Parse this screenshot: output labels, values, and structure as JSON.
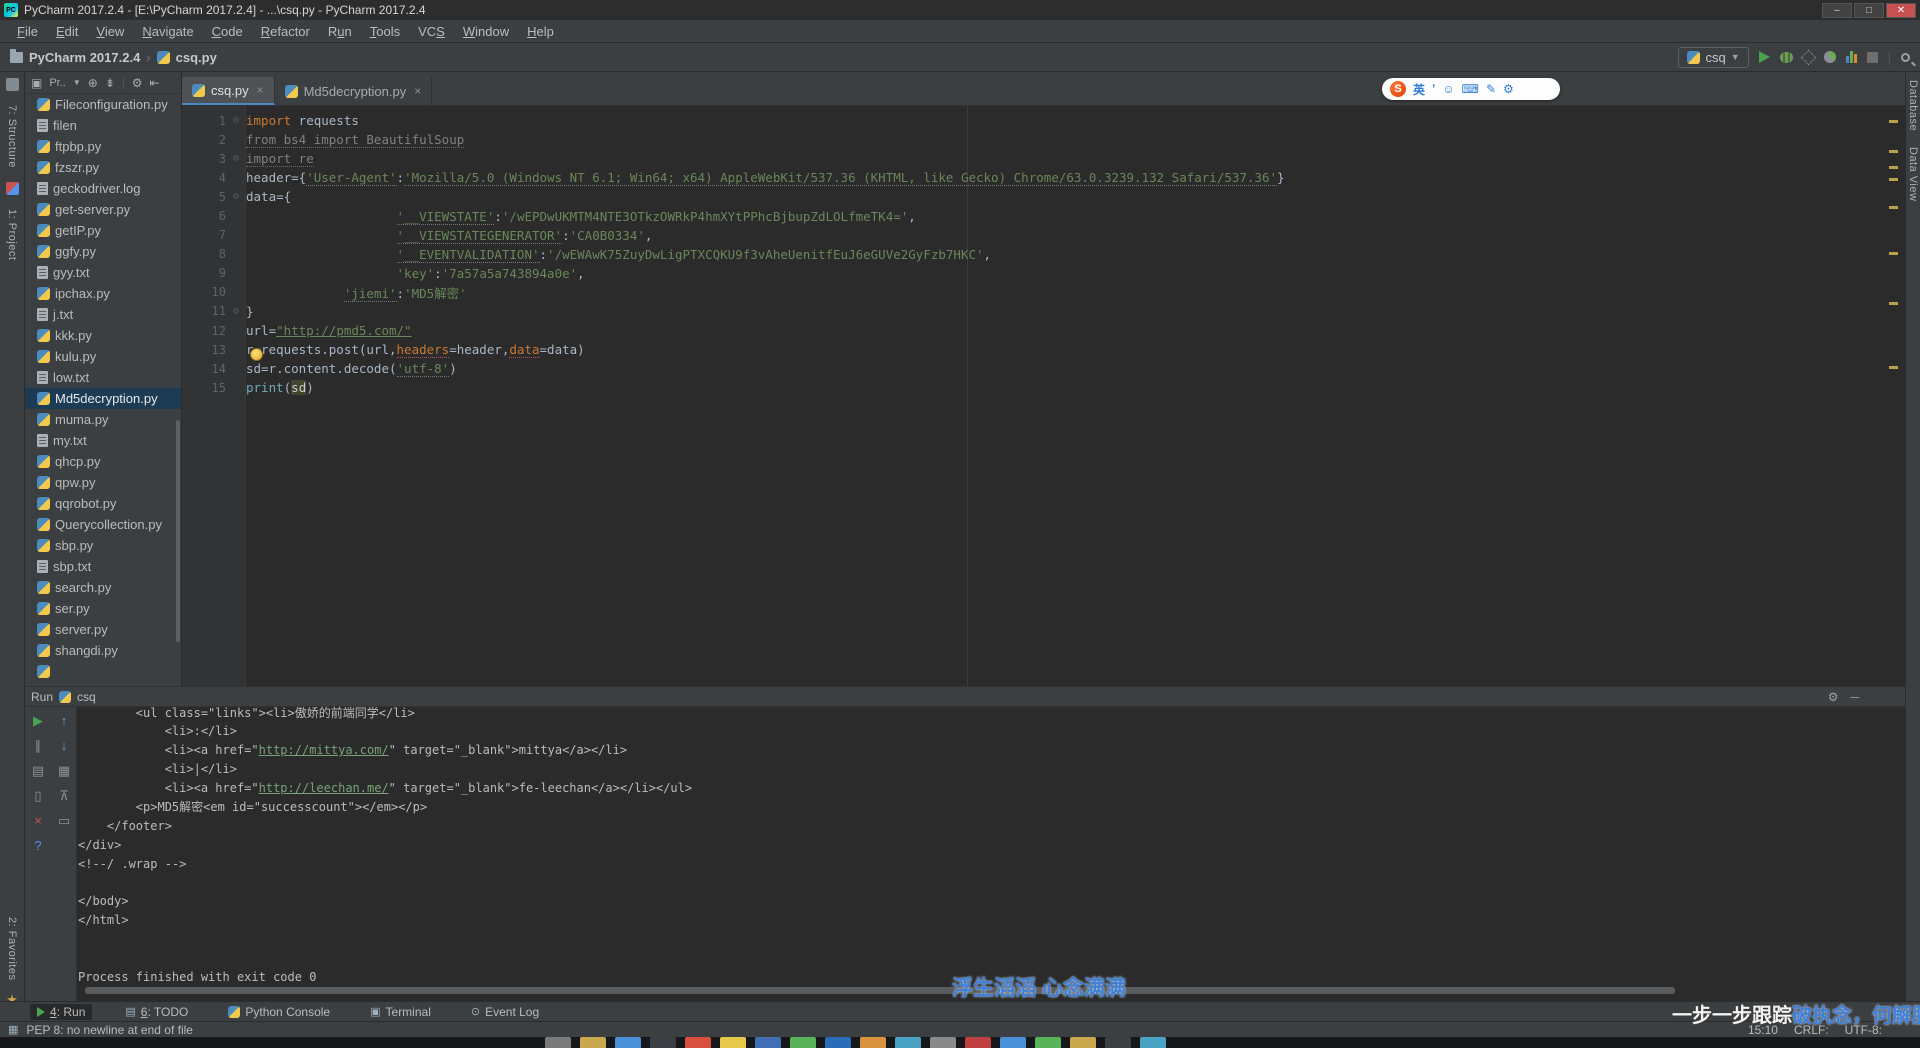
{
  "window": {
    "title": "PyCharm 2017.2.4 - [E:\\PyCharm 2017.2.4] - ...\\csq.py - PyCharm 2017.2.4",
    "controls": [
      "minimize",
      "maximize",
      "close"
    ]
  },
  "menu": {
    "items": [
      {
        "label": "File",
        "m": 0
      },
      {
        "label": "Edit",
        "m": 0
      },
      {
        "label": "View",
        "m": 0
      },
      {
        "label": "Navigate",
        "m": 0
      },
      {
        "label": "Code",
        "m": 0
      },
      {
        "label": "Refactor",
        "m": 0
      },
      {
        "label": "Run",
        "m": 1
      },
      {
        "label": "Tools",
        "m": 0
      },
      {
        "label": "VCS",
        "m": 2
      },
      {
        "label": "Window",
        "m": 0
      },
      {
        "label": "Help",
        "m": 0
      }
    ]
  },
  "toolbar": {
    "breadcrumb": [
      {
        "label": "PyCharm 2017.2.4",
        "icon": "folder-icon"
      },
      {
        "label": "csq.py",
        "icon": "python-icon"
      }
    ],
    "run_config": "csq"
  },
  "left_stripe": {
    "structure_label": "7: Structure",
    "project_label": "1: Project",
    "favorites_label": "2: Favorites"
  },
  "right_stripe": {
    "labels": [
      "Database",
      "Data View"
    ]
  },
  "project": {
    "view_label": "Pr..",
    "files": [
      {
        "name": "Fileconfiguration.py",
        "type": "py"
      },
      {
        "name": "filen",
        "type": "txt"
      },
      {
        "name": "ftpbp.py",
        "type": "py"
      },
      {
        "name": "fzszr.py",
        "type": "py"
      },
      {
        "name": "geckodriver.log",
        "type": "txt"
      },
      {
        "name": "get-server.py",
        "type": "py"
      },
      {
        "name": "getIP.py",
        "type": "py"
      },
      {
        "name": "ggfy.py",
        "type": "py"
      },
      {
        "name": "gyy.txt",
        "type": "txt"
      },
      {
        "name": "ipchax.py",
        "type": "py"
      },
      {
        "name": "j.txt",
        "type": "txt"
      },
      {
        "name": "kkk.py",
        "type": "py"
      },
      {
        "name": "kulu.py",
        "type": "py"
      },
      {
        "name": "low.txt",
        "type": "txt"
      },
      {
        "name": "Md5decryption.py",
        "type": "py",
        "selected": true
      },
      {
        "name": "muma.py",
        "type": "py"
      },
      {
        "name": "my.txt",
        "type": "txt"
      },
      {
        "name": "qhcp.py",
        "type": "py"
      },
      {
        "name": "qpw.py",
        "type": "py"
      },
      {
        "name": "qqrobot.py",
        "type": "py"
      },
      {
        "name": "Querycollection.py",
        "type": "py"
      },
      {
        "name": "sbp.py",
        "type": "py"
      },
      {
        "name": "sbp.txt",
        "type": "txt"
      },
      {
        "name": "search.py",
        "type": "py"
      },
      {
        "name": "ser.py",
        "type": "py"
      },
      {
        "name": "server.py",
        "type": "py"
      },
      {
        "name": "shangdi.py",
        "type": "py"
      },
      {
        "name": "",
        "type": "py",
        "partial": true
      }
    ]
  },
  "tabs": [
    {
      "label": "csq.py",
      "active": true
    },
    {
      "label": "Md5decryption.py",
      "active": false
    }
  ],
  "editor": {
    "lines": [
      {
        "n": 1,
        "fold": true,
        "segs": [
          {
            "t": "import",
            "c": "kw"
          },
          {
            "t": " requests"
          }
        ]
      },
      {
        "n": 2,
        "segs": [
          {
            "t": "from bs4 import BeautifulSoup",
            "c": "gray"
          }
        ]
      },
      {
        "n": 3,
        "fold": true,
        "segs": [
          {
            "t": "import re",
            "c": "gray"
          }
        ]
      },
      {
        "n": 4,
        "segs": [
          {
            "t": "header={"
          },
          {
            "t": "'User-Agent'",
            "c": "key"
          },
          {
            "t": ":"
          },
          {
            "t": "'Mozilla/5.0 (Windows NT 6.1; Win64; x64) AppleWebKit/537.36 (KHTML, like Gecko) Chrome/63.0.3239.132 Safari/537.36'",
            "c": "key"
          },
          {
            "t": "}"
          }
        ]
      },
      {
        "n": 5,
        "fold": true,
        "segs": [
          {
            "t": "data={"
          }
        ]
      },
      {
        "n": 6,
        "segs": [
          {
            "t": "                    "
          },
          {
            "t": "'__VIEWSTATE'",
            "c": "key"
          },
          {
            "t": ":"
          },
          {
            "t": "'/wEPDwUKMTM4NTE3OTkzOWRkP4hmXYtPPhcBjbupZdLOLfmeTK4='",
            "c": "str"
          },
          {
            "t": ","
          }
        ]
      },
      {
        "n": 7,
        "segs": [
          {
            "t": "                    "
          },
          {
            "t": "'__VIEWSTATEGENERATOR'",
            "c": "key"
          },
          {
            "t": ":"
          },
          {
            "t": "'CA0B0334'",
            "c": "str"
          },
          {
            "t": ","
          }
        ]
      },
      {
        "n": 8,
        "segs": [
          {
            "t": "                    "
          },
          {
            "t": "'__EVENTVALIDATION'",
            "c": "key"
          },
          {
            "t": ":"
          },
          {
            "t": "'/wEWAwK75ZuyDwLigPTXCQKU9f3vAheUenitfEuJ6eGUVe2GyFzb7HKC'",
            "c": "str"
          },
          {
            "t": ","
          }
        ]
      },
      {
        "n": 9,
        "segs": [
          {
            "t": "                    "
          },
          {
            "t": "'key'",
            "c": "str"
          },
          {
            "t": ":"
          },
          {
            "t": "'7a57a5a743894a0e'",
            "c": "str"
          },
          {
            "t": ","
          }
        ]
      },
      {
        "n": 10,
        "segs": [
          {
            "t": "             "
          },
          {
            "t": "'jiemi'",
            "c": "key"
          },
          {
            "t": ":"
          },
          {
            "t": "'MD5解密'",
            "c": "str"
          }
        ]
      },
      {
        "n": 11,
        "fold": true,
        "segs": [
          {
            "t": "}"
          }
        ]
      },
      {
        "n": 12,
        "segs": [
          {
            "t": "url="
          },
          {
            "t": "\"http://pmd5.com/\"",
            "c": "url"
          }
        ]
      },
      {
        "n": 13,
        "segs": [
          {
            "t": "r=requests.post(url,"
          },
          {
            "t": "headers",
            "c": "param"
          },
          {
            "t": "=header,"
          },
          {
            "t": "data",
            "c": "param"
          },
          {
            "t": "=data)"
          }
        ]
      },
      {
        "n": 14,
        "segs": [
          {
            "t": "sd=r.content.decode("
          },
          {
            "t": "'utf-8'",
            "c": "key"
          },
          {
            "t": ")"
          }
        ]
      },
      {
        "n": 15,
        "segs": [
          {
            "t": "print",
            "c": "builtin"
          },
          {
            "t": "("
          },
          {
            "t": "sd",
            "c": "hl"
          },
          {
            "t": ")"
          }
        ]
      }
    ]
  },
  "run_panel": {
    "title": "Run",
    "config": "csq",
    "header_icons": [
      "⚙",
      "─"
    ],
    "toolbar": [
      {
        "glyph": "▶",
        "color": "#4aa14f",
        "name": "rerun-button"
      },
      {
        "glyph": "↑",
        "color": "#61a2c8",
        "name": "up-stack-trace-button"
      },
      {
        "glyph": "∥",
        "color": "#8a8f92",
        "name": "pause-button"
      },
      {
        "glyph": "↓",
        "color": "#61a2c8",
        "name": "down-stack-trace-button"
      },
      {
        "glyph": "▤",
        "color": "#8a8f92",
        "name": "soft-wrap-button"
      },
      {
        "glyph": "▦",
        "color": "#8a8f92",
        "name": "restore-layout-button"
      },
      {
        "glyph": "▯",
        "color": "#8a8f92",
        "name": "print-button"
      },
      {
        "glyph": "⊼",
        "color": "#8a8f92",
        "name": "scroll-to-end-button"
      },
      {
        "glyph": "×",
        "color": "#c75450",
        "name": "close-button"
      },
      {
        "glyph": "▭",
        "color": "#8a8f92",
        "name": "clear-button"
      },
      {
        "glyph": "?",
        "color": "#5394ec",
        "name": "help-button"
      }
    ],
    "console": [
      {
        "segs": [
          {
            "t": "        <ul class=\"links\"><li>傲娇的前端同学</li>"
          }
        ]
      },
      {
        "segs": [
          {
            "t": "            <li>:</li>"
          }
        ]
      },
      {
        "segs": [
          {
            "t": "            <li><a href=\""
          },
          {
            "t": "http://mittya.com/",
            "c": "lnk"
          },
          {
            "t": "\" target=\"_blank\">mittya</a></li>"
          }
        ]
      },
      {
        "segs": [
          {
            "t": "            <li>|</li>"
          }
        ]
      },
      {
        "segs": [
          {
            "t": "            <li><a href=\""
          },
          {
            "t": "http://leechan.me/",
            "c": "lnk"
          },
          {
            "t": "\" target=\"_blank\">fe-leechan</a></li></ul>"
          }
        ]
      },
      {
        "segs": [
          {
            "t": "        <p>MD5解密<em id=\"successcount\"></em></p>"
          }
        ]
      },
      {
        "segs": [
          {
            "t": "    </footer>"
          }
        ]
      },
      {
        "segs": [
          {
            "t": "</div>"
          }
        ]
      },
      {
        "segs": [
          {
            "t": "<!--/ .wrap -->"
          }
        ]
      },
      {
        "segs": [
          {
            "t": ""
          }
        ]
      },
      {
        "segs": [
          {
            "t": "</body>"
          }
        ]
      },
      {
        "segs": [
          {
            "t": "</html>"
          }
        ]
      },
      {
        "segs": [
          {
            "t": ""
          }
        ]
      },
      {
        "segs": [
          {
            "t": ""
          }
        ]
      },
      {
        "segs": [
          {
            "t": "Process finished with exit code 0"
          }
        ]
      }
    ]
  },
  "toolwindow_bar": {
    "items": [
      {
        "label": "4: Run",
        "icon": "run",
        "active": true,
        "m": 0
      },
      {
        "label": "6: TODO",
        "icon": "todo",
        "m": 0
      },
      {
        "label": "Python Console",
        "icon": "python",
        "m": -1
      },
      {
        "label": "Terminal",
        "icon": "terminal",
        "m": -1
      },
      {
        "label": "Event Log",
        "icon": "eventlog",
        "m": -1
      }
    ]
  },
  "status_bar": {
    "message": "PEP 8: no newline at end of file",
    "right": [
      "15:10",
      "CRLF:",
      "UTF-8:"
    ]
  },
  "ime_bar": {
    "logo": "S",
    "items": [
      "英",
      "’",
      "☺",
      "⌨",
      "✎",
      "⚙"
    ]
  },
  "watermarks": {
    "center": "浮生滔滔  心念满满",
    "corner_white": "一步一步跟踪",
    "corner_blue": "破执念，何解脱"
  },
  "taskbar": {
    "colors": [
      "#7a7a7a",
      "#caa94e",
      "#4a90d9",
      "#3b3f44",
      "#d94f3d",
      "#e8c84a",
      "#3f6fb5",
      "#59b359",
      "#2b6cb8",
      "#d9923d",
      "#4aa3c4",
      "#8a8a8a",
      "#bf4040",
      "#4a90d9",
      "#59b359",
      "#caa94e",
      "#3b3f44",
      "#4aa3c4"
    ]
  },
  "colors": {
    "accent_blue": "#4a88c7",
    "selection": "#1c3c55",
    "run_green": "#4aa14f",
    "warning_stripe": "#b8a24a"
  }
}
